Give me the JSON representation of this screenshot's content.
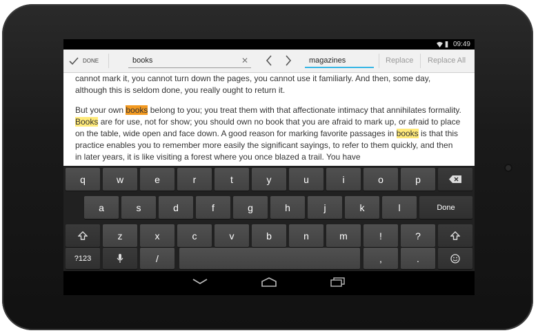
{
  "status": {
    "time": "09:49"
  },
  "actionbar": {
    "done_label": "DONE",
    "find_value": "books",
    "replace_value": "magazines",
    "replace_label": "Replace",
    "replace_all_label": "Replace All"
  },
  "content": {
    "p1": "cannot mark it, you cannot turn down the pages, you cannot use it familiarly. And then, some day, although this is seldom done, you really ought to return it.",
    "p2": {
      "t1": "But your own ",
      "m1": "books",
      "t2": " belong to you; you treat them with that affectionate intimacy that annihilates formality. ",
      "m2": "Books",
      "t3": " are for use, not for show; you should own no book that you are afraid to mark up, or afraid to place on the table, wide open and face down. A good reason for marking favorite passages in ",
      "m3": "books",
      "t4": " is that this practice enables you to remember more easily the significant sayings, to refer to them quickly, and then in later years, it is like visiting a forest where you once blazed a trail. You have"
    }
  },
  "keyboard": {
    "row1": [
      "q",
      "w",
      "e",
      "r",
      "t",
      "y",
      "u",
      "i",
      "o",
      "p"
    ],
    "row2": [
      "a",
      "s",
      "d",
      "f",
      "g",
      "h",
      "j",
      "k",
      "l"
    ],
    "row3": [
      "z",
      "x",
      "c",
      "v",
      "b",
      "n",
      "m",
      "!",
      "?"
    ],
    "done_label": "Done",
    "symbols_label": "?123",
    "slash": "/",
    "comma": ",",
    "period": "."
  },
  "icons": [
    "check-icon",
    "clear-icon",
    "chevron-left-icon",
    "chevron-right-icon",
    "backspace-icon",
    "shift-icon",
    "mic-icon",
    "emoji-icon",
    "back-icon",
    "home-icon",
    "recents-icon",
    "wifi-icon",
    "battery-icon"
  ],
  "colors": {
    "accent": "#33b5e5",
    "match": "#ffea7a",
    "current_match": "#f39a21"
  }
}
